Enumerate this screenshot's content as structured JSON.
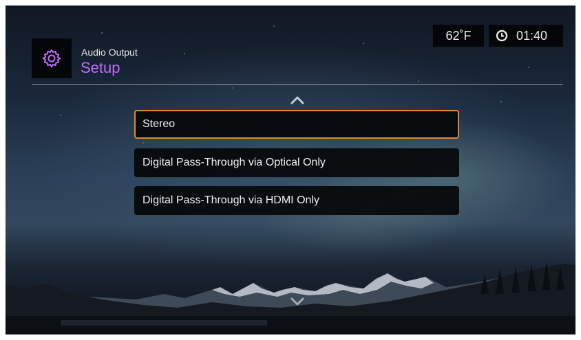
{
  "header": {
    "section": "Audio Output",
    "title": "Setup",
    "icon": "gear-icon"
  },
  "status": {
    "temperature": "62˚F",
    "time": "01:40",
    "clock_icon": "clock-icon"
  },
  "menu": {
    "items": [
      {
        "label": "Stereo",
        "selected": true
      },
      {
        "label": "Digital Pass-Through via Optical Only",
        "selected": false
      },
      {
        "label": "Digital Pass-Through via HDMI Only",
        "selected": false
      }
    ]
  },
  "colors": {
    "accent_title": "#c36bff",
    "selection_border": "#e08a2e",
    "panel": "#050608"
  },
  "icons": {
    "scroll_up": "chevron-up-icon",
    "scroll_down": "chevron-down-icon"
  }
}
